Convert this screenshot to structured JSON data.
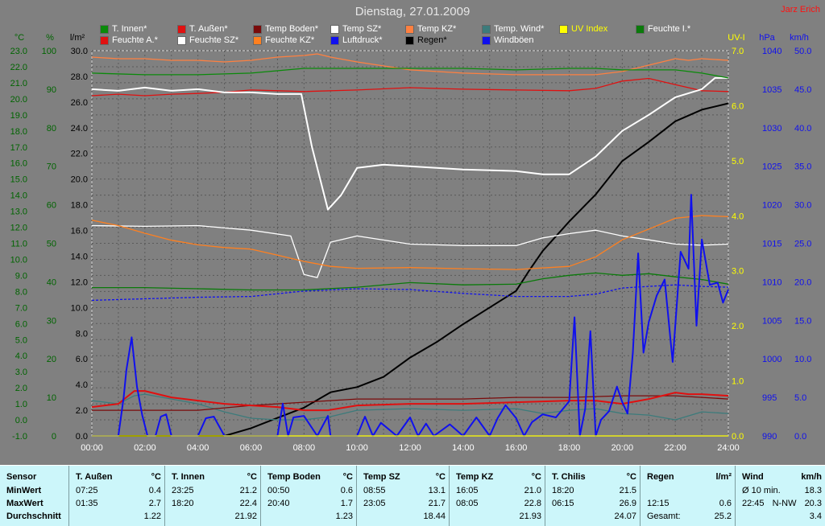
{
  "title": "Dienstag, 27.01.2009",
  "author": "Jarz Erich",
  "legend": [
    {
      "label": "T. Innen*",
      "color": "#0a8a0a"
    },
    {
      "label": "T. Außen*",
      "color": "#e01010"
    },
    {
      "label": "Temp Boden*",
      "color": "#7a0a0a"
    },
    {
      "label": "Temp SZ*",
      "color": "#ffffff"
    },
    {
      "label": "Temp KZ*",
      "color": "#ff8040"
    },
    {
      "label": "Temp. Wind*",
      "color": "#3c7b7b"
    },
    {
      "label": "UV Index",
      "color": "#ffff00"
    },
    {
      "label": "Feuchte I.*",
      "color": "#0a7a0a"
    },
    {
      "label": "Feuchte A.*",
      "color": "#e01010"
    },
    {
      "label": "Feuchte SZ*",
      "color": "#ffffff"
    },
    {
      "label": "Feuchte KZ*",
      "color": "#ff8020"
    },
    {
      "label": "Luftdruck*",
      "color": "#1010ee"
    },
    {
      "label": "Regen*",
      "color": "#000000"
    },
    {
      "label": "Windböen",
      "color": "#1010ee"
    }
  ],
  "chart_data": {
    "type": "line",
    "title": "Dienstag, 27.01.2009",
    "x_ticks": [
      "00:00",
      "02:00",
      "04:00",
      "06:00",
      "08:00",
      "10:00",
      "12:00",
      "14:00",
      "16:00",
      "18:00",
      "20:00",
      "22:00",
      "24:00"
    ],
    "axes": {
      "temp": {
        "unit": "°C",
        "ylim": [
          -1.0,
          23.0
        ],
        "ticks": [
          "23.0",
          "22.0",
          "21.0",
          "20.0",
          "19.0",
          "18.0",
          "17.0",
          "16.0",
          "15.0",
          "14.0",
          "13.0",
          "12.0",
          "11.0",
          "10.0",
          "9.0",
          "8.0",
          "7.0",
          "6.0",
          "5.0",
          "4.0",
          "3.0",
          "2.0",
          "1.0",
          "0.0",
          "-1.0"
        ],
        "color": "#006400"
      },
      "humidity": {
        "unit": "%",
        "ylim": [
          0,
          100
        ],
        "ticks": [
          "100",
          "90",
          "80",
          "70",
          "60",
          "50",
          "40",
          "30",
          "20",
          "10",
          "0"
        ],
        "color": "#006400"
      },
      "rain": {
        "unit": "l/m²",
        "ylim": [
          0,
          30
        ],
        "ticks": [
          "30.0",
          "28.0",
          "26.0",
          "24.0",
          "22.0",
          "20.0",
          "18.0",
          "16.0",
          "14.0",
          "12.0",
          "10.0",
          "8.0",
          "6.0",
          "4.0",
          "2.0",
          "0.0"
        ],
        "color": "#000000"
      },
      "uv": {
        "unit": "UV-I",
        "ylim": [
          0,
          7
        ],
        "ticks": [
          "7.0",
          "6.0",
          "5.0",
          "4.0",
          "3.0",
          "2.0",
          "1.0",
          "0.0"
        ],
        "color": "#ffff00"
      },
      "pressure": {
        "unit": "hPa",
        "ylim": [
          990,
          1040
        ],
        "ticks": [
          "1040",
          "1035",
          "1030",
          "1025",
          "1020",
          "1015",
          "1010",
          "1005",
          "1000",
          "995",
          "990"
        ],
        "color": "#1010ee"
      },
      "wind": {
        "unit": "km/h",
        "ylim": [
          0,
          50
        ],
        "ticks": [
          "50.0",
          "45.0",
          "40.0",
          "35.0",
          "30.0",
          "25.0",
          "20.0",
          "15.0",
          "10.0",
          "5.0",
          "0.0"
        ],
        "color": "#1010ee"
      }
    },
    "series": [
      {
        "name": "T. Innen*",
        "axis": "temp",
        "color": "#0a8a0a",
        "x": [
          0,
          2,
          4,
          6,
          8,
          10,
          12,
          14,
          16,
          18,
          19,
          20,
          22,
          23,
          24
        ],
        "y": [
          21.6,
          21.5,
          21.5,
          21.6,
          21.9,
          21.9,
          21.9,
          21.9,
          21.8,
          21.9,
          21.9,
          21.8,
          21.8,
          21.6,
          21.3
        ]
      },
      {
        "name": "T. Außen*",
        "axis": "temp",
        "color": "#e01010",
        "x": [
          0,
          1,
          1.6,
          2,
          3,
          4,
          5,
          6,
          7,
          8,
          8.9,
          10,
          12,
          14,
          16,
          18,
          19,
          20,
          21,
          22,
          22.5,
          23,
          24
        ],
        "y": [
          0.8,
          1.0,
          1.8,
          1.8,
          1.4,
          1.2,
          1.0,
          0.9,
          0.8,
          0.6,
          0.6,
          0.9,
          1.0,
          1.0,
          1.1,
          1.2,
          1.2,
          1.0,
          1.3,
          1.7,
          1.6,
          1.6,
          1.5
        ]
      },
      {
        "name": "Temp Boden*",
        "axis": "temp",
        "color": "#7a0a0a",
        "x": [
          0,
          2,
          4,
          6,
          8,
          10,
          12,
          14,
          16,
          18,
          20,
          22,
          24
        ],
        "y": [
          0.6,
          0.6,
          0.6,
          0.9,
          1.1,
          1.3,
          1.3,
          1.3,
          1.4,
          1.4,
          1.5,
          1.5,
          1.3
        ]
      },
      {
        "name": "Temp SZ*",
        "axis": "temp",
        "color": "#ffffff",
        "x": [
          0,
          1,
          2,
          3,
          4,
          5,
          6,
          7,
          7.9,
          8.3,
          8.9,
          9.4,
          10,
          11,
          12,
          14,
          16,
          17,
          18,
          19,
          20,
          21,
          22,
          23,
          23.5,
          24
        ],
        "y": [
          20.6,
          20.5,
          20.7,
          20.5,
          20.6,
          20.4,
          20.4,
          20.3,
          20.3,
          17.0,
          13.1,
          14.0,
          15.7,
          15.9,
          15.8,
          15.6,
          15.5,
          15.3,
          15.3,
          16.4,
          18.0,
          19.0,
          20.1,
          20.6,
          21.3,
          21.3
        ]
      },
      {
        "name": "Temp KZ*",
        "axis": "temp",
        "color": "#ff8040",
        "x": [
          0,
          1,
          2,
          3,
          4,
          5,
          6,
          7,
          8,
          8.5,
          9,
          10,
          12,
          14,
          16,
          18,
          19,
          20,
          21,
          22,
          22.5,
          23,
          24
        ],
        "y": [
          22.6,
          22.5,
          22.5,
          22.4,
          22.4,
          22.3,
          22.4,
          22.6,
          22.7,
          22.8,
          22.6,
          22.3,
          21.8,
          21.6,
          21.5,
          21.5,
          21.5,
          21.7,
          22.1,
          22.5,
          22.4,
          22.5,
          22.4
        ]
      },
      {
        "name": "Temp. Wind*",
        "axis": "temp",
        "color": "#3c7b7b",
        "x": [
          0,
          1,
          1.6,
          2,
          3,
          4,
          5,
          6,
          7,
          8,
          9,
          10,
          12,
          14,
          16,
          17,
          18,
          19,
          20,
          21,
          22,
          23,
          24
        ],
        "y": [
          1.2,
          1.0,
          1.5,
          1.6,
          1.3,
          1.0,
          0.5,
          0.1,
          0.0,
          0.0,
          0.2,
          0.6,
          0.7,
          0.6,
          0.7,
          0.4,
          0.6,
          0.7,
          0.4,
          0.3,
          0.0,
          0.5,
          0.4
        ]
      },
      {
        "name": "UV Index",
        "axis": "uv",
        "color": "#ffff00",
        "x": [
          0,
          24
        ],
        "y": [
          0.0,
          0.0
        ]
      },
      {
        "name": "Feuchte I.*",
        "axis": "humidity",
        "color": "#0a7a0a",
        "x": [
          0,
          2,
          4,
          6,
          8,
          10,
          12,
          14,
          16,
          17,
          18,
          19,
          20,
          21,
          22,
          23,
          24
        ],
        "y": [
          38.5,
          38.5,
          38.2,
          37.9,
          37.9,
          38.6,
          39.8,
          39.2,
          39.4,
          40.8,
          41.7,
          42.3,
          41.7,
          42.1,
          41.3,
          40.6,
          39.4
        ]
      },
      {
        "name": "Feuchte A.*",
        "axis": "humidity",
        "color": "#e01010",
        "x": [
          0,
          1,
          2,
          3,
          4,
          5,
          6,
          7,
          8,
          10,
          12,
          14,
          16,
          18,
          19,
          20,
          21,
          22,
          23,
          24
        ],
        "y": [
          88.3,
          88.7,
          88.3,
          88.7,
          88.9,
          89.2,
          89.8,
          89.6,
          89.4,
          89.8,
          90.4,
          90.0,
          89.8,
          89.6,
          90.2,
          92.1,
          92.8,
          91.2,
          89.6,
          89.4
        ]
      },
      {
        "name": "Feuchte SZ*",
        "axis": "humidity",
        "color": "#ffffff",
        "x": [
          0,
          2,
          4,
          6,
          7.5,
          8,
          8.5,
          9,
          10,
          12,
          14,
          16,
          17,
          18,
          19,
          20,
          21,
          22,
          23,
          24
        ],
        "y": [
          54.6,
          54.4,
          54.6,
          53.4,
          51.9,
          41.9,
          41.1,
          50.3,
          51.9,
          49.8,
          49.4,
          49.4,
          51.4,
          52.5,
          53.4,
          51.9,
          50.9,
          49.8,
          49.5,
          49.8
        ]
      },
      {
        "name": "Feuchte KZ*",
        "axis": "humidity",
        "color": "#ff8020",
        "x": [
          0,
          1,
          2,
          3,
          4,
          5,
          6,
          7,
          8,
          9,
          10,
          12,
          14,
          16,
          18,
          19,
          20,
          21,
          22,
          23,
          24
        ],
        "y": [
          56.0,
          54.6,
          52.6,
          50.8,
          49.6,
          48.9,
          48.5,
          46.9,
          45.3,
          44.0,
          43.5,
          43.7,
          43.4,
          43.2,
          44.0,
          46.5,
          50.9,
          53.7,
          56.5,
          57.2,
          56.9
        ]
      },
      {
        "name": "Luftdruck*",
        "axis": "pressure",
        "color": "#1010ee",
        "dashed": true,
        "x": [
          0,
          2,
          4,
          6,
          8,
          10,
          12,
          14,
          16,
          18,
          19,
          20,
          21,
          22,
          23,
          24
        ],
        "y": [
          1007.6,
          1007.8,
          1008.0,
          1008.1,
          1008.8,
          1009.1,
          1009.0,
          1008.5,
          1008.1,
          1008.1,
          1008.4,
          1009.2,
          1009.4,
          1009.6,
          1009.4,
          1009.3
        ]
      },
      {
        "name": "Regen*",
        "axis": "rain",
        "color": "#000000",
        "x": [
          0,
          5,
          6,
          7,
          8,
          9,
          10,
          11,
          12,
          13,
          14,
          15,
          16,
          16.5,
          17,
          18,
          19,
          20,
          21,
          22,
          23,
          24
        ],
        "y": [
          0.0,
          0.0,
          0.6,
          1.4,
          2.2,
          3.4,
          3.8,
          4.6,
          6.1,
          7.3,
          8.7,
          10.0,
          11.3,
          12.9,
          14.4,
          16.7,
          18.8,
          21.4,
          22.9,
          24.5,
          25.4,
          25.9
        ]
      },
      {
        "name": "Windböen",
        "axis": "wind",
        "color": "#1010ee",
        "x": [
          0,
          0.5,
          1,
          1.2,
          1.3,
          1.5,
          1.7,
          1.9,
          2.1,
          2.4,
          2.6,
          2.8,
          3,
          4,
          4.3,
          4.6,
          5,
          7,
          7.2,
          7.4,
          7.6,
          8,
          8.5,
          8.9,
          9,
          9.5,
          10,
          10.3,
          10.6,
          10.9,
          11.5,
          12,
          12.3,
          12.6,
          12.9,
          13.5,
          14,
          14.5,
          15,
          15.3,
          15.6,
          16,
          16.3,
          16.6,
          17,
          17.5,
          18,
          18.2,
          18.4,
          18.6,
          18.8,
          19,
          19.2,
          19.5,
          19.8,
          20,
          20.2,
          20.4,
          20.6,
          20.8,
          21,
          21.3,
          21.6,
          21.9,
          22.2,
          22.5,
          22.6,
          22.8,
          23,
          23.3,
          23.6,
          23.8,
          24
        ],
        "y": [
          0,
          0,
          0,
          5.0,
          8.5,
          12.8,
          6.4,
          2.7,
          0,
          0,
          2.5,
          2.8,
          0,
          0,
          2.3,
          2.5,
          0,
          0,
          4.2,
          0,
          2.4,
          2.6,
          0,
          2.6,
          0,
          0,
          0,
          2.5,
          0,
          1.7,
          0,
          2.4,
          0,
          1.6,
          0,
          1.5,
          0,
          2.4,
          0,
          2.3,
          4.0,
          2.3,
          0,
          1.8,
          2.8,
          2.4,
          4.5,
          15.4,
          0,
          3.5,
          13.6,
          0,
          2.1,
          3.2,
          6.4,
          4.4,
          2.9,
          10.8,
          23.7,
          10.8,
          14.8,
          18.2,
          20.3,
          9.6,
          23.9,
          21.7,
          31.3,
          14.3,
          25.5,
          19.6,
          19.9,
          17.3,
          19.0
        ]
      }
    ]
  },
  "stats": {
    "label_sensor": "Sensor",
    "label_min": "MinWert",
    "label_max": "MaxWert",
    "label_avg": "Durchschnitt",
    "columns": [
      {
        "name": "T. Außen",
        "unit": "°C",
        "min_time": "07:25",
        "min": "0.4",
        "max_time": "01:35",
        "max": "2.7",
        "avg": "1.22"
      },
      {
        "name": "T. Innen",
        "unit": "°C",
        "min_time": "23:25",
        "min": "21.2",
        "max_time": "18:20",
        "max": "22.4",
        "avg": "21.92"
      },
      {
        "name": "Temp Boden",
        "unit": "°C",
        "min_time": "00:50",
        "min": "0.6",
        "max_time": "20:40",
        "max": "1.7",
        "avg": "1.23"
      },
      {
        "name": "Temp SZ",
        "unit": "°C",
        "min_time": "08:55",
        "min": "13.1",
        "max_time": "23:05",
        "max": "21.7",
        "avg": "18.44"
      },
      {
        "name": "Temp KZ",
        "unit": "°C",
        "min_time": "16:05",
        "min": "21.0",
        "max_time": "08:05",
        "max": "22.8",
        "avg": "21.93"
      },
      {
        "name": "T. Chilis",
        "unit": "°C",
        "min_time": "18:20",
        "min": "21.5",
        "max_time": "06:15",
        "max": "26.9",
        "avg": "24.07"
      }
    ],
    "rain": {
      "name": "Regen",
      "unit": "l/m²",
      "max_time": "12:15",
      "max": "0.6",
      "total_label": "Gesamt:",
      "total": "25.2"
    },
    "wind": {
      "name": "Wind",
      "unit": "km/h",
      "min_label": "Ø 10 min.",
      "min": "18.3",
      "max_time": "22:45",
      "max_dir": "N-NW",
      "max": "20.3",
      "avg": "3.4"
    }
  }
}
